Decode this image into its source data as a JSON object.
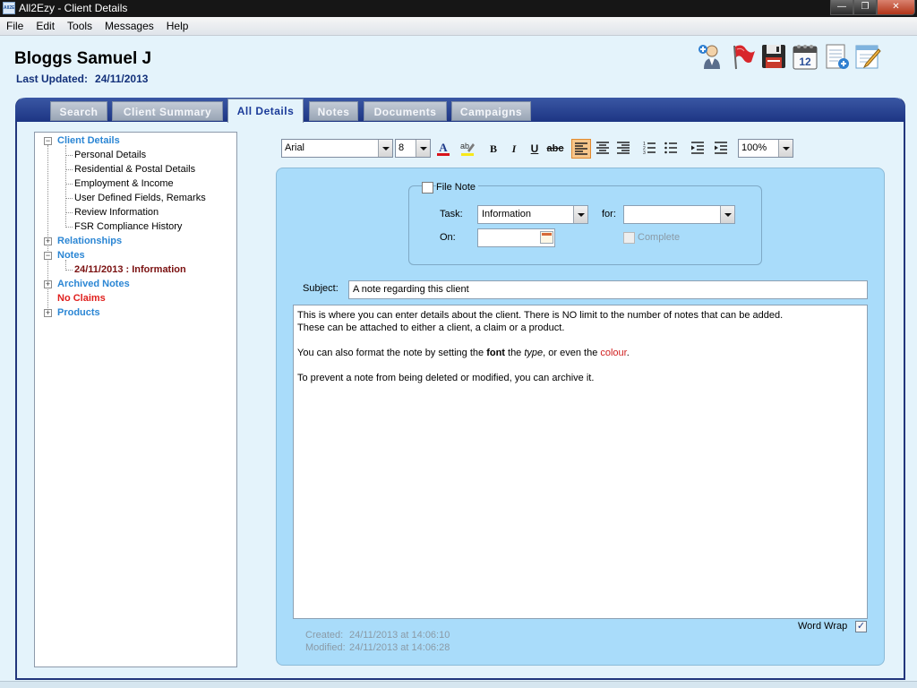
{
  "window": {
    "title": "All2Ezy - Client Details",
    "app_icon_text": "All2Ezy"
  },
  "menu": [
    "File",
    "Edit",
    "Tools",
    "Messages",
    "Help"
  ],
  "client": {
    "name": "Bloggs Samuel J",
    "last_updated_label": "Last Updated:",
    "last_updated": "24/11/2013"
  },
  "toolbar_icons": [
    "add-user-icon",
    "flag-icon",
    "save-icon",
    "calendar-icon",
    "add-note-icon",
    "edit-note-icon"
  ],
  "calendar_day": "12",
  "tabs": [
    {
      "label": "Search",
      "active": false
    },
    {
      "label": "Client Summary",
      "active": false
    },
    {
      "label": "All Details",
      "active": true
    },
    {
      "label": "Notes",
      "active": false
    },
    {
      "label": "Documents",
      "active": false
    },
    {
      "label": "Campaigns",
      "active": false
    }
  ],
  "tree": {
    "client_details": "Client Details",
    "client_children": [
      "Personal Details",
      "Residential & Postal Details",
      "Employment & Income",
      "User Defined Fields, Remarks",
      "Review Information",
      "FSR Compliance History"
    ],
    "relationships": "Relationships",
    "notes": "Notes",
    "note_item": "24/11/2013 : Information",
    "archived_notes": "Archived Notes",
    "no_claims": "No Claims",
    "products": "Products"
  },
  "format": {
    "font": "Arial",
    "size": "8",
    "zoom": "100%",
    "bold": "B",
    "italic": "I",
    "underline": "U",
    "strike": "abc"
  },
  "file_note": {
    "label": "File Note",
    "checked": false,
    "task_label": "Task:",
    "task_value": "Information",
    "for_label": "for:",
    "for_value": "",
    "on_label": "On:",
    "on_value": "",
    "complete_label": "Complete"
  },
  "subject": {
    "label": "Subject:",
    "value": "A note regarding this client"
  },
  "body": {
    "line1": "This is where you can enter details about the client. There is NO limit to the number of notes that can be added.",
    "line2": "These can be attached to either a client, a claim or a product.",
    "line3_a": "You can also format the note by setting the ",
    "line3_font": "font",
    "line3_b": " the ",
    "line3_type": "type",
    "line3_c": ", or even the ",
    "line3_colour": "colour",
    "line3_d": ".",
    "line4": "To prevent a note from being deleted or modified, you can archive it."
  },
  "footer": {
    "created_label": "Created:",
    "created": "24/11/2013 at 14:06:10",
    "modified_label": "Modified:",
    "modified": "24/11/2013 at 14:06:28",
    "word_wrap_label": "Word Wrap",
    "word_wrap": true
  },
  "colors": {
    "accent": "#1d3583",
    "tree_link": "#2b86d4",
    "panel": "#a9dcfa",
    "alert": "#e0201e"
  }
}
